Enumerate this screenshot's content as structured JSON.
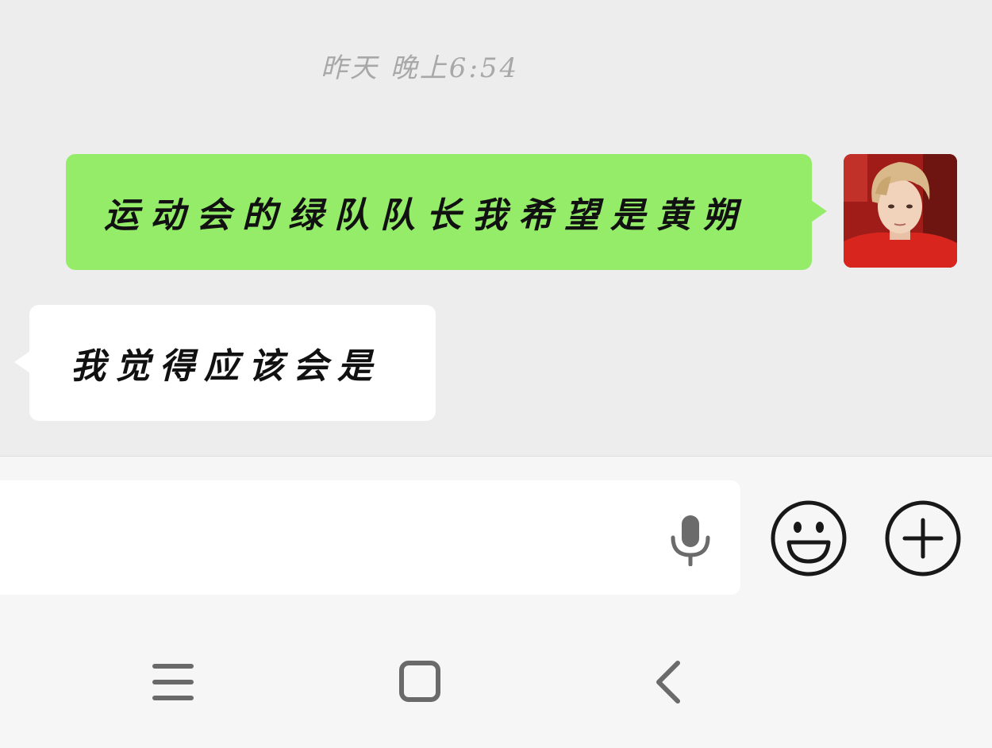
{
  "chat": {
    "timestamp": "昨天 晚上6:54",
    "messages": [
      {
        "direction": "out",
        "text": "运动会的绿队队长我希望是黄朔"
      },
      {
        "direction": "in",
        "text": "我觉得应该会是"
      }
    ]
  },
  "colors": {
    "background": "#ededed",
    "outgoing_bubble": "#95ec69",
    "incoming_bubble": "#ffffff",
    "input_bar": "#f6f6f6"
  },
  "input_bar": {
    "placeholder": "",
    "icons": [
      "microphone-icon",
      "emoji-icon",
      "plus-icon"
    ]
  },
  "nav_bar": {
    "icons": [
      "menu-icon",
      "home-icon",
      "back-icon"
    ]
  }
}
